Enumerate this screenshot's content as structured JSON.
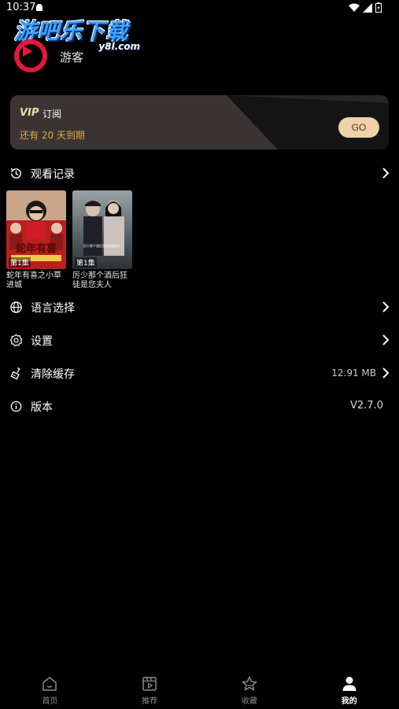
{
  "status_bar": {
    "time": "10:37"
  },
  "watermark": {
    "title": "游吧乐下载",
    "domain": "y8l.com"
  },
  "profile": {
    "username": "游客"
  },
  "vip": {
    "badge": "VIP",
    "label": "订阅",
    "expire": "还有 20 天到期",
    "go": "GO"
  },
  "history": {
    "label": "观看记录",
    "items": [
      {
        "title": "蛇年有喜之小草进城",
        "episode": "第1集",
        "poster_text": "蛇年有喜"
      },
      {
        "title": "厉少那个酒后狂徒是您夫人",
        "episode": "第1集",
        "poster_text": "厉少那个酒后狂徒是您夫人"
      }
    ]
  },
  "menu": {
    "language": "语言选择",
    "settings": "设置",
    "clear_cache": "清除缓存",
    "cache_size": "12.91 MB",
    "version_label": "版本",
    "version_value": "V2.7.0"
  },
  "nav": {
    "items": [
      {
        "label": "首页",
        "icon": "home-icon",
        "active": false
      },
      {
        "label": "推荐",
        "icon": "film-icon",
        "active": false
      },
      {
        "label": "收藏",
        "icon": "star-icon",
        "active": false
      },
      {
        "label": "我的",
        "icon": "person-icon",
        "active": true
      }
    ]
  },
  "colors": {
    "accent_gold": "#e0a94a",
    "go_button": "#f0d1a8",
    "avatar_red": "#e8163b"
  }
}
